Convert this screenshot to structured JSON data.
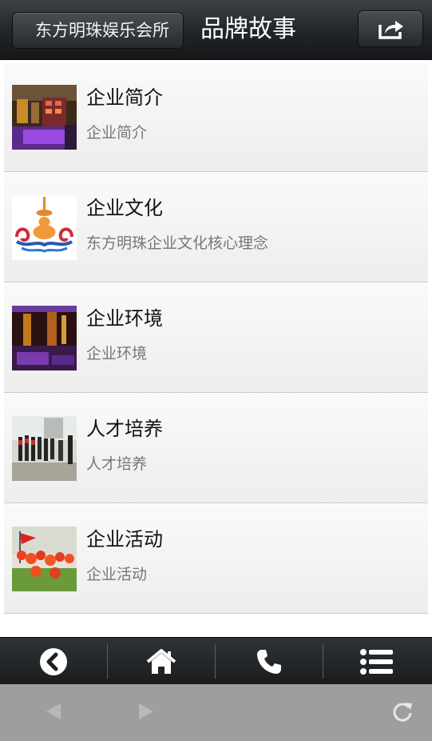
{
  "header": {
    "back_label": "东方明珠娱乐会所",
    "title": "品牌故事"
  },
  "items": [
    {
      "title": "企业简介",
      "subtitle": "企业简介"
    },
    {
      "title": "企业文化",
      "subtitle": "东方明珠企业文化核心理念"
    },
    {
      "title": "企业环境",
      "subtitle": "企业环境"
    },
    {
      "title": "人才培养",
      "subtitle": "人才培养"
    },
    {
      "title": "企业活动",
      "subtitle": "企业活动"
    }
  ],
  "toolbar": {
    "icons": [
      "back-circle-icon",
      "home-icon",
      "phone-icon",
      "list-menu-icon"
    ]
  },
  "browser": {
    "icons": [
      "prev-arrow-icon",
      "next-arrow-icon",
      "reload-icon"
    ]
  },
  "colors": {
    "header_bg": "#23272a",
    "list_bg": "#f3f3f3",
    "browser_bar": "#9e9e9e"
  }
}
